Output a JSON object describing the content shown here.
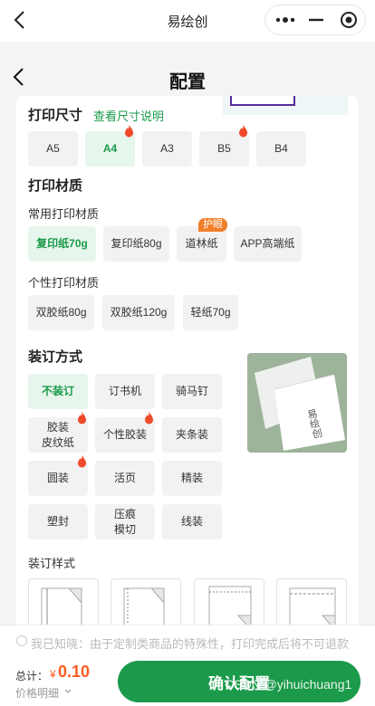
{
  "app": {
    "title": "易绘创",
    "capsule": {
      "more_icon": "more-dots-icon",
      "minimize_icon": "minimize-icon",
      "close_icon": "target-close-icon"
    }
  },
  "page": {
    "title": "配置"
  },
  "print_size": {
    "title": "打印尺寸",
    "help_link": "查看尺寸说明",
    "options": [
      {
        "label": "A5",
        "selected": false,
        "hot": false
      },
      {
        "label": "A4",
        "selected": true,
        "hot": true
      },
      {
        "label": "A3",
        "selected": false,
        "hot": false
      },
      {
        "label": "B5",
        "selected": false,
        "hot": true
      },
      {
        "label": "B4",
        "selected": false,
        "hot": false
      }
    ]
  },
  "print_material": {
    "title": "打印材质",
    "common_title": "常用打印材质",
    "common_options": [
      {
        "label": "复印纸70g",
        "selected": true
      },
      {
        "label": "复印纸80g",
        "selected": false
      },
      {
        "label": "道林纸",
        "selected": false,
        "badge": "护眼"
      },
      {
        "label": "APP高端纸",
        "selected": false
      }
    ],
    "custom_title": "个性打印材质",
    "custom_options": [
      {
        "label": "双胶纸80g"
      },
      {
        "label": "双胶纸120g"
      },
      {
        "label": "轻纸70g"
      }
    ]
  },
  "binding": {
    "title": "装订方式",
    "options": [
      {
        "label": "不装订",
        "selected": true,
        "hot": false
      },
      {
        "label": "订书机",
        "selected": false,
        "hot": false
      },
      {
        "label": "骑马钉",
        "selected": false,
        "hot": false
      },
      {
        "label": "胶装\n皮纹纸",
        "selected": false,
        "hot": true
      },
      {
        "label": "个性胶装",
        "selected": false,
        "hot": true
      },
      {
        "label": "夹条装",
        "selected": false,
        "hot": false
      },
      {
        "label": "圆装",
        "selected": false,
        "hot": true
      },
      {
        "label": "活页",
        "selected": false,
        "hot": false
      },
      {
        "label": "精装",
        "selected": false,
        "hot": false
      },
      {
        "label": "塑封",
        "selected": false,
        "hot": false
      },
      {
        "label": "压痕\n模切",
        "selected": false,
        "hot": false
      },
      {
        "label": "线装",
        "selected": false,
        "hot": false
      }
    ],
    "sample_text": "易绘创",
    "style_title": "装订样式"
  },
  "notice": {
    "text": "我已知晓：由于定制类商品的特殊性，打印完成后将不可退款"
  },
  "footer": {
    "total_label": "总计：",
    "currency": "¥",
    "total": "0.10",
    "detail_label": "价格明细",
    "confirm_label": "确认配置",
    "watermark": "CSDN @yihuichuang1"
  },
  "colors": {
    "accent": "#1a9a4a",
    "price": "#ff5a1f",
    "hot": "#f04a2a",
    "badge": "#f07f2a"
  }
}
